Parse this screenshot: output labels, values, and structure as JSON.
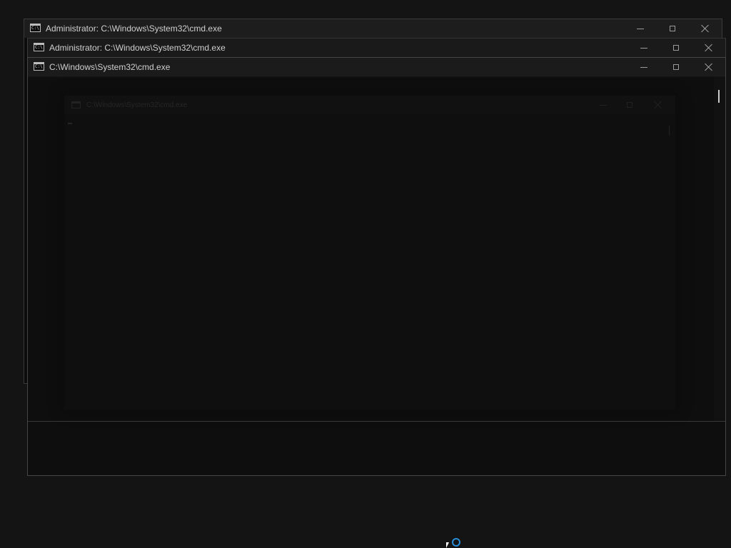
{
  "desktop": {
    "background_color": "#141414"
  },
  "windows": [
    {
      "id": "win1",
      "title": "Administrator: C:\\Windows\\System32\\cmd.exe",
      "icon": "cmd-icon",
      "focused": false
    },
    {
      "id": "win2",
      "title": "Administrator: C:\\Windows\\System32\\cmd.exe",
      "icon": "cmd-icon",
      "focused": false
    },
    {
      "id": "win3",
      "title": "C:\\Windows\\System32\\cmd.exe",
      "icon": "cmd-icon",
      "focused": true
    }
  ],
  "ghost_window": {
    "title": "C:\\Windows\\System32\\cmd.exe",
    "icon": "cmd-icon"
  },
  "icon_glyphs": {
    "cmd": "C:\\"
  },
  "cursor": {
    "type": "busy-arrow",
    "spinner_color": "#2a8dd8"
  }
}
